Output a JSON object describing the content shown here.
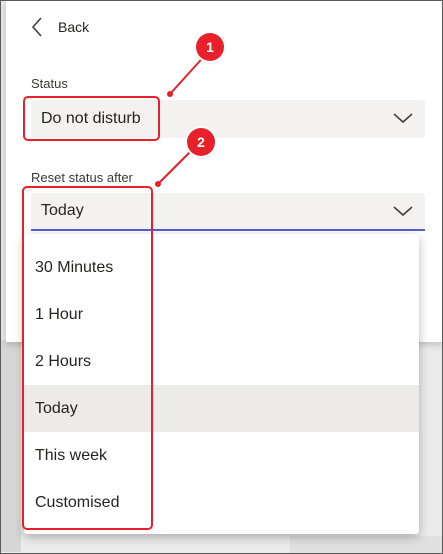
{
  "header": {
    "back_label": "Back"
  },
  "status": {
    "label": "Status",
    "value": "Do not disturb"
  },
  "reset": {
    "label": "Reset status after",
    "value": "Today",
    "options": [
      "30 Minutes",
      "1 Hour",
      "2 Hours",
      "Today",
      "This week",
      "Customised"
    ],
    "selected_index": 3
  },
  "annotations": {
    "badge_1": "1",
    "badge_2": "2",
    "color": "#e8202a"
  },
  "colors": {
    "accent_underline": "#5b5fc7",
    "selected_bg": "#edebe9"
  }
}
